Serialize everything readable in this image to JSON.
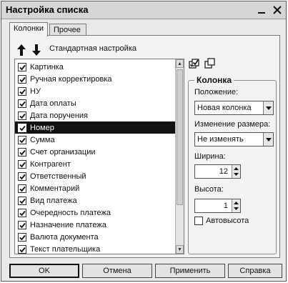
{
  "window": {
    "title": "Настройка списка"
  },
  "tabs": [
    {
      "label": "Колонки",
      "active": true
    },
    {
      "label": "Прочее",
      "active": false
    }
  ],
  "toolbar": {
    "standard_settings_label": "Стандартная настройка"
  },
  "columns_list": {
    "items": [
      {
        "label": "Картинка",
        "checked": true,
        "selected": false
      },
      {
        "label": "Ручная корректировка",
        "checked": true,
        "selected": false
      },
      {
        "label": "НУ",
        "checked": true,
        "selected": false
      },
      {
        "label": "Дата оплаты",
        "checked": true,
        "selected": false
      },
      {
        "label": "Дата поручения",
        "checked": true,
        "selected": false
      },
      {
        "label": "Номер",
        "checked": true,
        "selected": true
      },
      {
        "label": "Сумма",
        "checked": true,
        "selected": false
      },
      {
        "label": "Счет организации",
        "checked": true,
        "selected": false
      },
      {
        "label": "Контрагент",
        "checked": true,
        "selected": false
      },
      {
        "label": "Ответственный",
        "checked": true,
        "selected": false
      },
      {
        "label": "Комментарий",
        "checked": true,
        "selected": false
      },
      {
        "label": "Вид платежа",
        "checked": true,
        "selected": false
      },
      {
        "label": "Очередность платежа",
        "checked": true,
        "selected": false
      },
      {
        "label": "Назначение платежа",
        "checked": true,
        "selected": false
      },
      {
        "label": "Валюта документа",
        "checked": true,
        "selected": false
      },
      {
        "label": "Текст плательщика",
        "checked": true,
        "selected": false
      }
    ]
  },
  "column_group": {
    "title": "Колонка",
    "position_label": "Положение:",
    "position_value": "Новая колонка",
    "resize_label": "Изменение размера:",
    "resize_value": "Не изменять",
    "width_label": "Ширина:",
    "width_value": "12",
    "height_label": "Высота:",
    "height_value": "1",
    "autoheight_label": "Автовысота",
    "autoheight_checked": false
  },
  "buttons": {
    "ok": "OK",
    "cancel": "Отмена",
    "apply": "Применить",
    "help": "Справка"
  }
}
